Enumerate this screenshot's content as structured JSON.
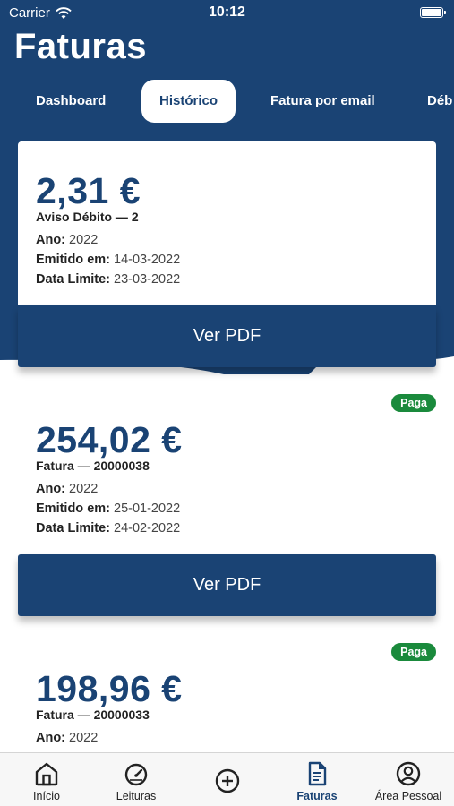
{
  "status_bar": {
    "carrier": "Carrier",
    "time": "10:12"
  },
  "page": {
    "title": "Faturas"
  },
  "tabs": [
    {
      "label": "Dashboard"
    },
    {
      "label": "Histórico",
      "active": true
    },
    {
      "label": "Fatura por email"
    },
    {
      "label": "Déb"
    }
  ],
  "invoices": [
    {
      "amount": "2,31 €",
      "subtitle": "Aviso Débito — 2",
      "year_label": "Ano:",
      "year": "2022",
      "issued_label": "Emitido em:",
      "issued": "14-03-2022",
      "due_label": "Data Limite:",
      "due": "23-03-2022",
      "pdf_label": "Ver PDF"
    },
    {
      "badge": "Paga",
      "amount": "254,02 €",
      "subtitle": "Fatura — 20000038",
      "year_label": "Ano:",
      "year": "2022",
      "issued_label": "Emitido em:",
      "issued": "25-01-2022",
      "due_label": "Data Limite:",
      "due": "24-02-2022",
      "pdf_label": "Ver PDF"
    },
    {
      "badge": "Paga",
      "amount": "198,96 €",
      "subtitle": "Fatura — 20000033",
      "year_label": "Ano:",
      "year": "2022"
    }
  ],
  "tabbar": [
    {
      "label": "Início",
      "icon": "home-icon"
    },
    {
      "label": "Leituras",
      "icon": "gauge-icon"
    },
    {
      "label": "",
      "icon": "plus-circle-icon"
    },
    {
      "label": "Faturas",
      "icon": "document-icon",
      "active": true
    },
    {
      "label": "Área Pessoal",
      "icon": "user-circle-icon"
    }
  ],
  "colors": {
    "primary": "#1a4374",
    "paid_badge": "#1a8a3c",
    "tabbar_bg": "#f7f7f7"
  }
}
